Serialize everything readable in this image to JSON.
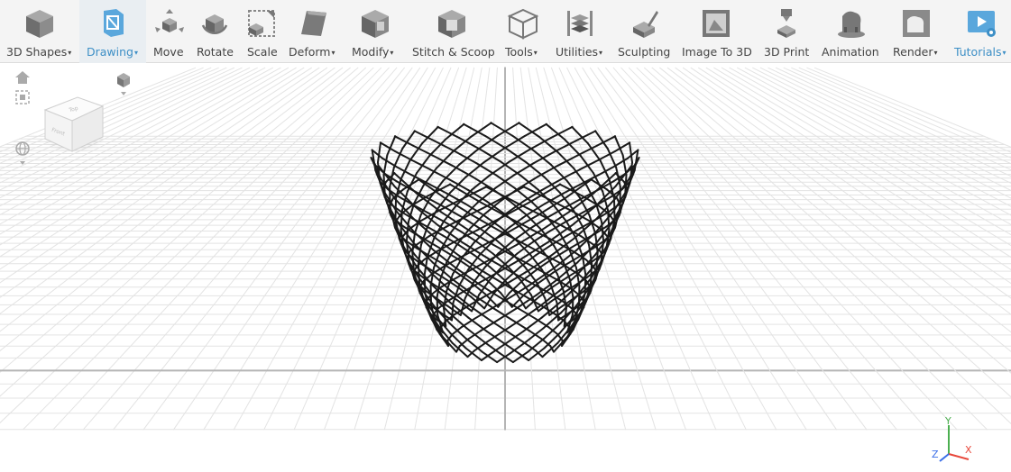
{
  "toolbar": {
    "items": [
      {
        "label": "3D Shapes",
        "icon": "cube-icon",
        "dropdown": true
      },
      {
        "label": "Drawing",
        "icon": "drawing-icon",
        "dropdown": true,
        "active": true
      },
      {
        "label": "Move",
        "icon": "move-icon",
        "dropdown": false
      },
      {
        "label": "Rotate",
        "icon": "rotate-icon",
        "dropdown": false
      },
      {
        "label": "Scale",
        "icon": "scale-icon",
        "dropdown": false
      },
      {
        "label": "Deform",
        "icon": "deform-icon",
        "dropdown": true
      },
      {
        "label": "Modify",
        "icon": "modify-icon",
        "dropdown": true
      },
      {
        "label": "Stitch & Scoop",
        "icon": "stitch-scoop-icon",
        "dropdown": false
      },
      {
        "label": "Tools",
        "icon": "tools-icon",
        "dropdown": true
      },
      {
        "label": "Utilities",
        "icon": "utilities-icon",
        "dropdown": true
      },
      {
        "label": "Sculpting",
        "icon": "sculpting-icon",
        "dropdown": false
      },
      {
        "label": "Image To 3D",
        "icon": "image-to-3d-icon",
        "dropdown": false
      },
      {
        "label": "3D Print",
        "icon": "3d-print-icon",
        "dropdown": false
      },
      {
        "label": "Animation",
        "icon": "animation-icon",
        "dropdown": false
      },
      {
        "label": "Render",
        "icon": "render-icon",
        "dropdown": true
      },
      {
        "label": "Tutorials",
        "icon": "tutorials-icon",
        "dropdown": true
      }
    ],
    "caret": "▾"
  },
  "viewcube": {
    "top_label": "Top",
    "front_label": "Front"
  },
  "axes": {
    "x": "X",
    "y": "Y",
    "z": "Z",
    "x_color": "#e8483b",
    "y_color": "#4caf50",
    "z_color": "#3b6fe8"
  },
  "colors": {
    "accent": "#3d8fc6",
    "toolbar_bg": "#f4f4f4",
    "icon_gray": "#7a7a7a",
    "mesh": "#1a1a1a"
  }
}
